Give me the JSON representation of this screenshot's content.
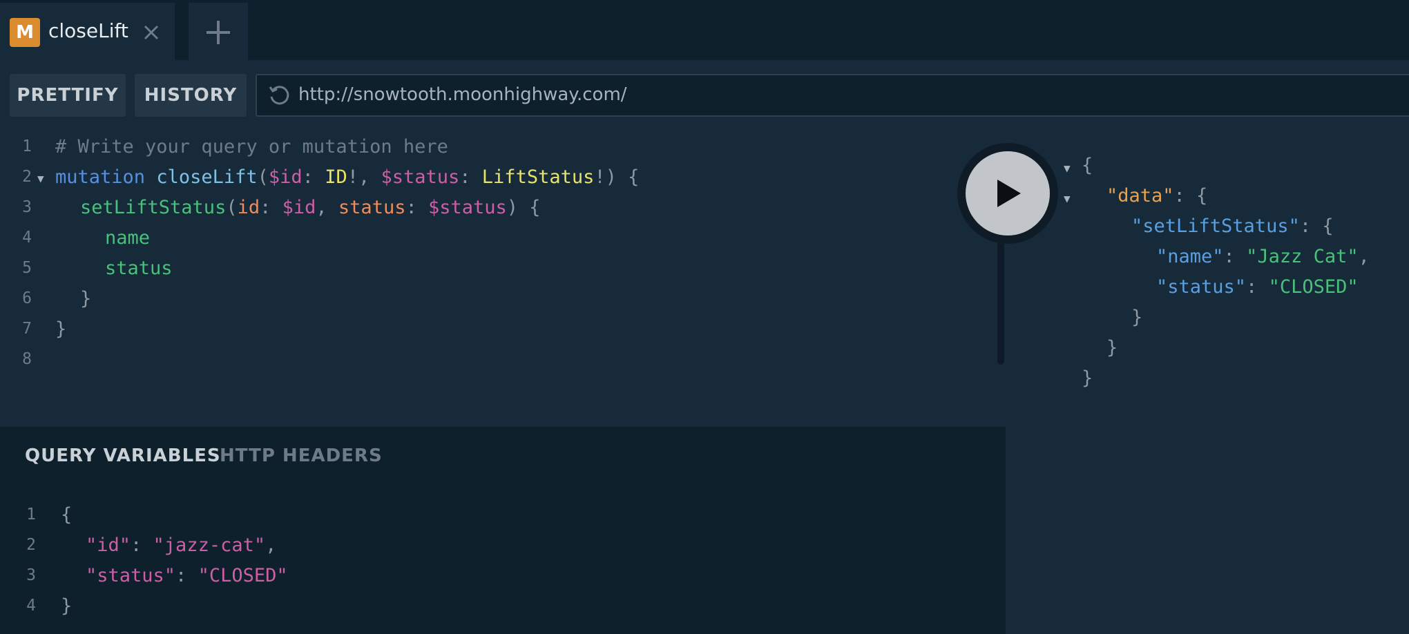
{
  "tab": {
    "badge": "M",
    "title": "closeLift"
  },
  "toolbar": {
    "prettify_label": "PRETTIFY",
    "history_label": "HISTORY",
    "url": "http://snowtooth.moonhighway.com/"
  },
  "editor": {
    "lines": [
      {
        "num": "1",
        "comment": "# Write your query or mutation here"
      },
      {
        "num": "2",
        "keyword": "mutation",
        "name": "closeLift",
        "p1": "(",
        "v1": "$id",
        "c1": ": ",
        "t1": "ID",
        "b1": "!, ",
        "v2": "$status",
        "c2": ": ",
        "t2": "LiftStatus",
        "b2": "!) {"
      },
      {
        "num": "3",
        "field": "setLiftStatus",
        "p1": "(",
        "a1": "id",
        "c1": ": ",
        "v1": "$id",
        "s1": ", ",
        "a2": "status",
        "c2": ": ",
        "v2": "$status",
        "e": ") {"
      },
      {
        "num": "4",
        "field": "name"
      },
      {
        "num": "5",
        "field": "status"
      },
      {
        "num": "6",
        "text": "}"
      },
      {
        "num": "7",
        "text": "}"
      },
      {
        "num": "8"
      }
    ]
  },
  "variables": {
    "tabs": [
      "QUERY VARIABLES",
      "HTTP HEADERS"
    ],
    "lines": [
      {
        "num": "1",
        "text": "{"
      },
      {
        "num": "2",
        "key": "\"id\"",
        "sep": ": ",
        "val": "\"jazz-cat\"",
        "end": ","
      },
      {
        "num": "3",
        "key": "\"status\"",
        "sep": ": ",
        "val": "\"CLOSED\"",
        "end": ""
      },
      {
        "num": "4",
        "text": "}"
      }
    ]
  },
  "result": {
    "open": "{",
    "data_key": "\"data\"",
    "sep": ": {",
    "slp_key": "\"setLiftStatus\"",
    "name_key": "\"name\"",
    "name_val": "\"Jazz Cat\"",
    "status_key": "\"status\"",
    "status_val": "\"CLOSED\"",
    "colon": ": ",
    "comma": ",",
    "close": "}"
  },
  "icons": {
    "close": "close-icon",
    "add": "plus-icon",
    "reload": "reload-icon",
    "run": "play-icon"
  }
}
